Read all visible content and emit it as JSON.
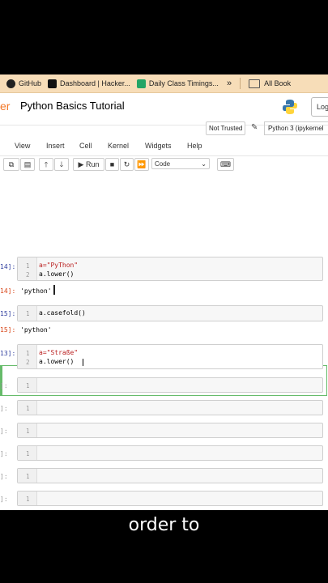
{
  "bookmarks": [
    {
      "label": "GitHub",
      "icon": "github-icon"
    },
    {
      "label": "Dashboard | Hacker...",
      "icon": "hackerrank-icon"
    },
    {
      "label": "Daily Class Timings...",
      "icon": "sheets-icon"
    }
  ],
  "bookmarks_more": "»",
  "all_bookmarks": "All Book",
  "header": {
    "brand": "er",
    "notebook_title": "Python Basics Tutorial",
    "logout": "Log"
  },
  "status": {
    "trusted": "Not Trusted",
    "kernel": "Python 3 (ipykernel"
  },
  "menu": [
    "View",
    "Insert",
    "Cell",
    "Kernel",
    "Widgets",
    "Help"
  ],
  "toolbar": {
    "run": "Run",
    "cell_type": "Code"
  },
  "cells": [
    {
      "prompt": "14]:",
      "lines": [
        "a=\"PyThon\"",
        "a.lower()"
      ],
      "out_prompt": "14]:",
      "output": "'python'"
    },
    {
      "prompt": "15]:",
      "lines": [
        "a.casefold()"
      ],
      "out_prompt": "15]:",
      "output": "'python'"
    },
    {
      "prompt": "13]:",
      "lines": [
        "a=\"Straße\"",
        "a.lower()"
      ]
    }
  ],
  "empty_prompt": "]:",
  "line_numbers": [
    "1",
    "2"
  ],
  "caption": "order to",
  "colors": {
    "accent_orange": "#f37726",
    "selected_border": "#66bb6a",
    "bookmarks_bg": "#f7ddb8"
  }
}
